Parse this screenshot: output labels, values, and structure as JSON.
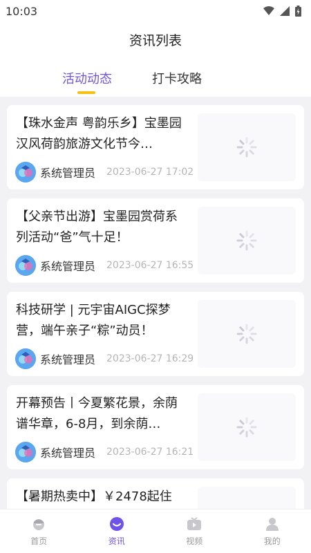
{
  "status_bar": {
    "time": "10:03",
    "icons": [
      "wifi-icon",
      "signal-icon",
      "battery-icon"
    ]
  },
  "page": {
    "title": "资讯列表"
  },
  "tabs": [
    {
      "label": "活动动态",
      "active": true
    },
    {
      "label": "打卡攻略",
      "active": false
    }
  ],
  "articles": [
    {
      "title": "【珠水金声 粤韵乐乡】宝墨园汉风荷韵旅游文化节今…",
      "author": "系统管理员",
      "date": "2023-06-27 17:02"
    },
    {
      "title": "【父亲节出游】宝墨园赏荷系列活动“爸”气十足！",
      "author": "系统管理员",
      "date": "2023-06-27 16:55"
    },
    {
      "title": "科技研学 | 元宇宙AIGC探梦营，端午亲子“粽”动员！",
      "author": "系统管理员",
      "date": "2023-06-27 16:29"
    },
    {
      "title": "开幕预告丨今夏繁花景，余荫谱华章，6-8月，到余荫…",
      "author": "系统管理员",
      "date": "2023-06-27 16:21"
    },
    {
      "title": "【暑期热卖中】￥2478起住",
      "author": "",
      "date": ""
    }
  ],
  "tabbar": [
    {
      "label": "首页",
      "icon": "home-icon",
      "active": false
    },
    {
      "label": "资讯",
      "icon": "news-icon",
      "active": true
    },
    {
      "label": "视频",
      "icon": "video-icon",
      "active": false
    },
    {
      "label": "我的",
      "icon": "profile-icon",
      "active": false
    }
  ],
  "colors": {
    "accent": "#6f52e8",
    "tab_indicator": "#f5c013",
    "background": "#f2f2f5"
  }
}
